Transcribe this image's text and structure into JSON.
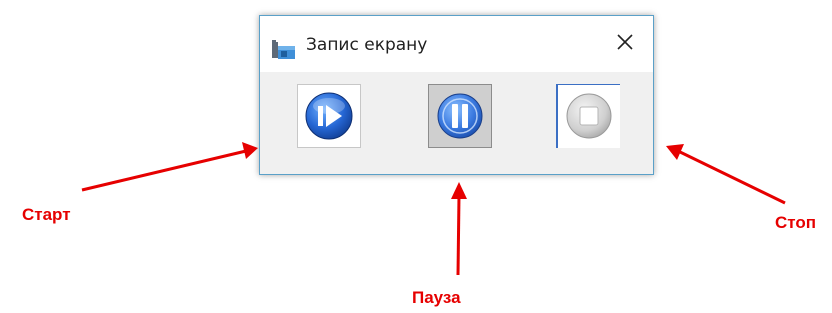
{
  "window": {
    "title": "Запис екрану",
    "title_icon": "camera-icon",
    "close_icon": "close-icon"
  },
  "toolbar": {
    "buttons": [
      {
        "id": "start",
        "icon": "play-icon"
      },
      {
        "id": "pause",
        "icon": "pause-icon"
      },
      {
        "id": "stop",
        "icon": "stop-icon"
      }
    ]
  },
  "annotations": {
    "start": "Старт",
    "pause": "Пауза",
    "stop": "Стоп"
  },
  "colors": {
    "annotation": "#e60000",
    "window_border": "#5aa0c8",
    "button_blue": "#2f6fd6"
  }
}
